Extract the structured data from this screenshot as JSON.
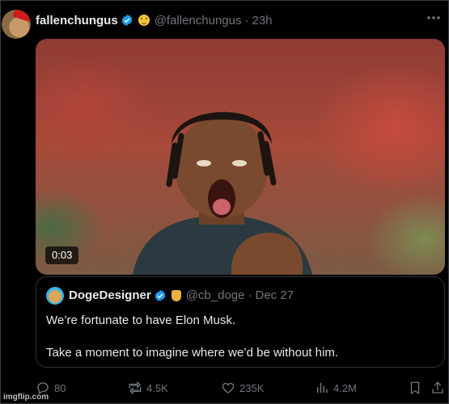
{
  "post": {
    "author_name": "fallenchungus",
    "handle": "@fallenchungus",
    "separator": "·",
    "time": "23h",
    "video_duration": "0:03"
  },
  "quoted_post": {
    "author_name": "DogeDesigner",
    "handle": "@cb_doge",
    "separator": "·",
    "date": "Dec 27",
    "line1": "We’re fortunate to have Elon Musk.",
    "line2": "Take a moment to imagine where we’d be without him."
  },
  "actions": {
    "replies": "80",
    "reposts": "4.5K",
    "likes": "235K",
    "views": "4.2M"
  },
  "watermark": "imgflip.com",
  "icons": {
    "verified": "verified-badge-icon",
    "more": "more-options-icon",
    "reply": "reply-icon",
    "repost": "repost-icon",
    "like": "like-icon",
    "views": "views-icon",
    "bookmark": "bookmark-icon",
    "share": "share-icon"
  },
  "colors": {
    "background": "#000000",
    "text": "#e7e9ea",
    "muted": "#71767b",
    "verified": "#1d9bf0"
  }
}
